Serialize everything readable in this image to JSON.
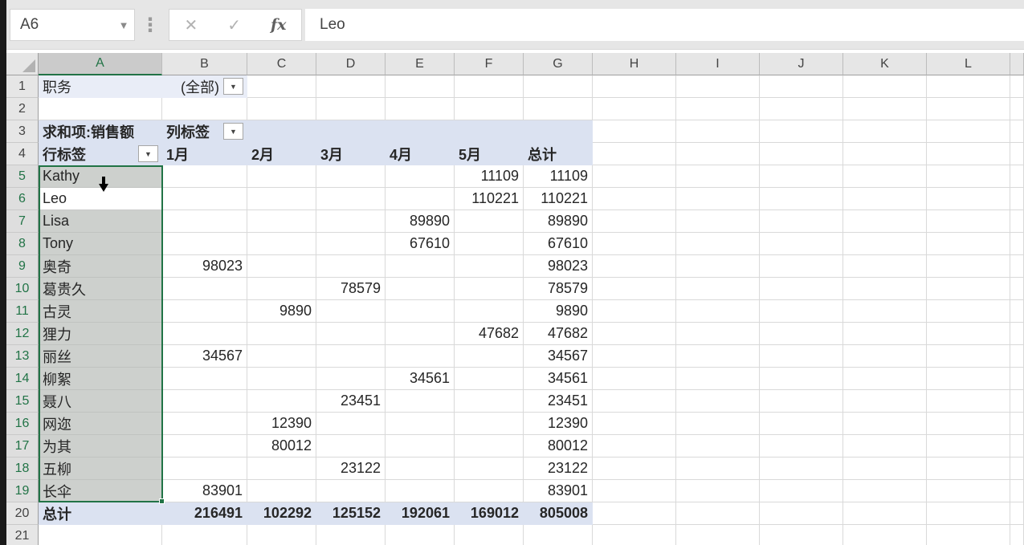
{
  "formula_bar": {
    "name_box": "A6",
    "dots_icon": "⋮",
    "cancel_icon": "✕",
    "enter_icon": "✓",
    "fx_label": "fx",
    "formula": "Leo"
  },
  "grid": {
    "column_letters": [
      "A",
      "B",
      "C",
      "D",
      "E",
      "F",
      "G",
      "H",
      "I",
      "J",
      "K",
      "L"
    ],
    "row_count": 21,
    "selected_column": "A",
    "selected_row_start": 5,
    "selected_row_end": 19,
    "active_cell": "A6"
  },
  "pivot": {
    "filter_label": "职务",
    "filter_value": "(全部)",
    "measure_label": "求和项:销售额",
    "col_label": "列标签",
    "row_label": "行标签",
    "months": [
      "1月",
      "2月",
      "3月",
      "4月",
      "5月"
    ],
    "total_label": "总计",
    "rows": [
      {
        "name": "Kathy",
        "values": [
          "",
          "",
          "",
          "",
          "11109"
        ],
        "total": "11109"
      },
      {
        "name": "Leo",
        "values": [
          "",
          "",
          "",
          "",
          "110221"
        ],
        "total": "110221"
      },
      {
        "name": "Lisa",
        "values": [
          "",
          "",
          "",
          "89890",
          ""
        ],
        "total": "89890"
      },
      {
        "name": "Tony",
        "values": [
          "",
          "",
          "",
          "67610",
          ""
        ],
        "total": "67610"
      },
      {
        "name": "奥奇",
        "values": [
          "98023",
          "",
          "",
          "",
          ""
        ],
        "total": "98023"
      },
      {
        "name": "葛贵久",
        "values": [
          "",
          "",
          "78579",
          "",
          ""
        ],
        "total": "78579"
      },
      {
        "name": "古灵",
        "values": [
          "",
          "9890",
          "",
          "",
          ""
        ],
        "total": "9890"
      },
      {
        "name": "狸力",
        "values": [
          "",
          "",
          "",
          "",
          "47682"
        ],
        "total": "47682"
      },
      {
        "name": "丽丝",
        "values": [
          "34567",
          "",
          "",
          "",
          ""
        ],
        "total": "34567"
      },
      {
        "name": "柳絮",
        "values": [
          "",
          "",
          "",
          "34561",
          ""
        ],
        "total": "34561"
      },
      {
        "name": "聂八",
        "values": [
          "",
          "",
          "23451",
          "",
          ""
        ],
        "total": "23451"
      },
      {
        "name": "网迩",
        "values": [
          "",
          "12390",
          "",
          "",
          ""
        ],
        "total": "12390"
      },
      {
        "name": "为其",
        "values": [
          "",
          "80012",
          "",
          "",
          ""
        ],
        "total": "80012"
      },
      {
        "name": "五柳",
        "values": [
          "",
          "",
          "23122",
          "",
          ""
        ],
        "total": "23122"
      },
      {
        "name": "长伞",
        "values": [
          "83901",
          "",
          "",
          "",
          ""
        ],
        "total": "83901"
      }
    ],
    "grand_totals": [
      "216491",
      "102292",
      "125152",
      "192061",
      "169012"
    ],
    "grand_total_sum": "805008"
  },
  "colors": {
    "accent_green": "#217346",
    "pivot_header_fill": "#dbe2f1",
    "filter_row_fill": "#e9edf7",
    "selection_fill": "#cdd0cd",
    "chrome_gray": "#e6e6e6"
  }
}
